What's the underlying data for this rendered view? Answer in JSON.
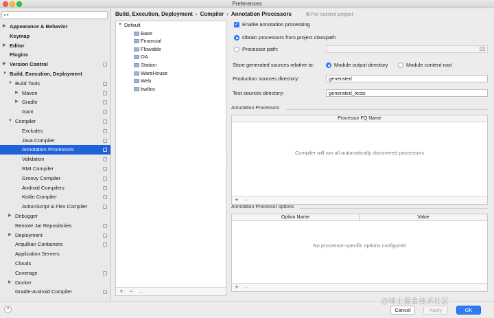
{
  "window": {
    "title": "Preferences"
  },
  "search": {
    "placeholder": "",
    "value": ""
  },
  "sidebar": {
    "items": [
      {
        "label": "Appearance & Behavior",
        "level": 0,
        "bold": true,
        "arrow": "right",
        "copy": false
      },
      {
        "label": "Keymap",
        "level": 0,
        "bold": true,
        "arrow": "",
        "copy": false
      },
      {
        "label": "Editor",
        "level": 0,
        "bold": true,
        "arrow": "right",
        "copy": false
      },
      {
        "label": "Plugins",
        "level": 0,
        "bold": true,
        "arrow": "",
        "copy": false
      },
      {
        "label": "Version Control",
        "level": 0,
        "bold": true,
        "arrow": "right",
        "copy": true
      },
      {
        "label": "Build, Execution, Deployment",
        "level": 0,
        "bold": true,
        "arrow": "down",
        "copy": false
      },
      {
        "label": "Build Tools",
        "level": 1,
        "bold": false,
        "arrow": "down",
        "copy": true
      },
      {
        "label": "Maven",
        "level": 2,
        "bold": false,
        "arrow": "right",
        "copy": true
      },
      {
        "label": "Gradle",
        "level": 2,
        "bold": false,
        "arrow": "right",
        "copy": true
      },
      {
        "label": "Gant",
        "level": 2,
        "bold": false,
        "arrow": "",
        "copy": true
      },
      {
        "label": "Compiler",
        "level": 1,
        "bold": false,
        "arrow": "down",
        "copy": true
      },
      {
        "label": "Excludes",
        "level": 2,
        "bold": false,
        "arrow": "",
        "copy": true
      },
      {
        "label": "Java Compiler",
        "level": 2,
        "bold": false,
        "arrow": "",
        "copy": true
      },
      {
        "label": "Annotation Processors",
        "level": 2,
        "bold": false,
        "arrow": "",
        "copy": true,
        "selected": true
      },
      {
        "label": "Validation",
        "level": 2,
        "bold": false,
        "arrow": "",
        "copy": true
      },
      {
        "label": "RMI Compiler",
        "level": 2,
        "bold": false,
        "arrow": "",
        "copy": true
      },
      {
        "label": "Groovy Compiler",
        "level": 2,
        "bold": false,
        "arrow": "",
        "copy": true
      },
      {
        "label": "Android Compilers",
        "level": 2,
        "bold": false,
        "arrow": "",
        "copy": true
      },
      {
        "label": "Kotlin Compiler",
        "level": 2,
        "bold": false,
        "arrow": "",
        "copy": true
      },
      {
        "label": "ActionScript & Flex Compiler",
        "level": 2,
        "bold": false,
        "arrow": "",
        "copy": true
      },
      {
        "label": "Debugger",
        "level": 1,
        "bold": false,
        "arrow": "right",
        "copy": false
      },
      {
        "label": "Remote Jar Repositories",
        "level": 1,
        "bold": false,
        "arrow": "",
        "copy": true
      },
      {
        "label": "Deployment",
        "level": 1,
        "bold": false,
        "arrow": "right",
        "copy": true
      },
      {
        "label": "Arquillian Containers",
        "level": 1,
        "bold": false,
        "arrow": "",
        "copy": true
      },
      {
        "label": "Application Servers",
        "level": 1,
        "bold": false,
        "arrow": "",
        "copy": false
      },
      {
        "label": "Clouds",
        "level": 1,
        "bold": false,
        "arrow": "",
        "copy": false
      },
      {
        "label": "Coverage",
        "level": 1,
        "bold": false,
        "arrow": "",
        "copy": true
      },
      {
        "label": "Docker",
        "level": 1,
        "bold": false,
        "arrow": "right",
        "copy": false
      },
      {
        "label": "Gradle-Android Compiler",
        "level": 1,
        "bold": false,
        "arrow": "",
        "copy": true
      }
    ]
  },
  "breadcrumb": {
    "items": [
      "Build, Execution, Deployment",
      "Compiler",
      "Annotation Processors"
    ],
    "separator": "›",
    "scope": "For current project"
  },
  "profiles": {
    "root": "Default",
    "children": [
      "Base",
      "Financial",
      "Flowable",
      "OA",
      "Station",
      "WareHouse",
      "Web",
      "bwlbis"
    ],
    "toolbar": {
      "add": "+",
      "remove": "−",
      "move": "→"
    }
  },
  "settings": {
    "enable_annotation": {
      "label": "Enable annotation processing",
      "checked": true
    },
    "obtain_classpath": {
      "label": "Obtain processors from project classpath",
      "selected": true
    },
    "processor_path": {
      "label": "Processor path:",
      "selected": false,
      "value": ""
    },
    "store_relative": {
      "label": "Store generated sources relative to:",
      "options": [
        {
          "label": "Module output directory",
          "selected": true
        },
        {
          "label": "Module content root",
          "selected": false
        }
      ]
    },
    "production_dir": {
      "label": "Production sources directory:",
      "value": "generated"
    },
    "test_dir": {
      "label": "Test sources directory:",
      "value": "generated_tests"
    }
  },
  "processors_section": {
    "title": "Annotation Processors",
    "column": "Processor FQ Name",
    "empty": "Compiler will run all automatically discovered processors",
    "toolbar": {
      "add": "+",
      "remove": "−"
    }
  },
  "options_section": {
    "title": "Annotation Processor options",
    "columns": [
      "Option Name",
      "Value"
    ],
    "empty": "No processor-specific options configured",
    "toolbar": {
      "add": "+",
      "remove": "−"
    }
  },
  "footer": {
    "help": "?",
    "cancel": "Cancel",
    "apply": "Apply",
    "ok": "OK",
    "watermark": "@稀土掘金技术社区"
  },
  "colors": {
    "selection": "#1f61d8",
    "accent": "#2d7cf6"
  },
  "icons": {
    "search": "search-icon",
    "folder": "folder-icon",
    "copy": "project-scope-icon"
  }
}
